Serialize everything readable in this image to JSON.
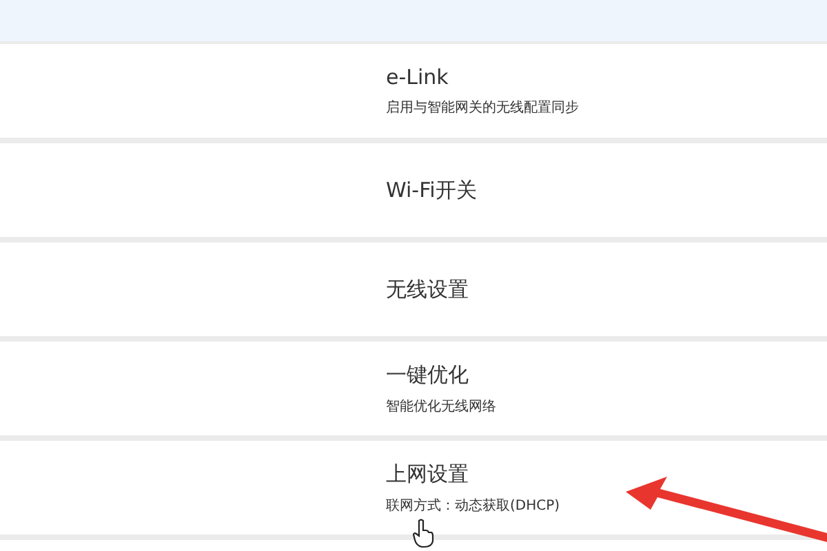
{
  "settings": [
    {
      "title": "e-Link",
      "subtitle": "启用与智能网关的无线配置同步"
    },
    {
      "title": "Wi-Fi开关"
    },
    {
      "title": "无线设置"
    },
    {
      "title": "一键优化",
      "subtitle": "智能优化无线网络"
    },
    {
      "title": "上网设置",
      "subtitle": "联网方式：动态获取(DHCP)"
    }
  ]
}
